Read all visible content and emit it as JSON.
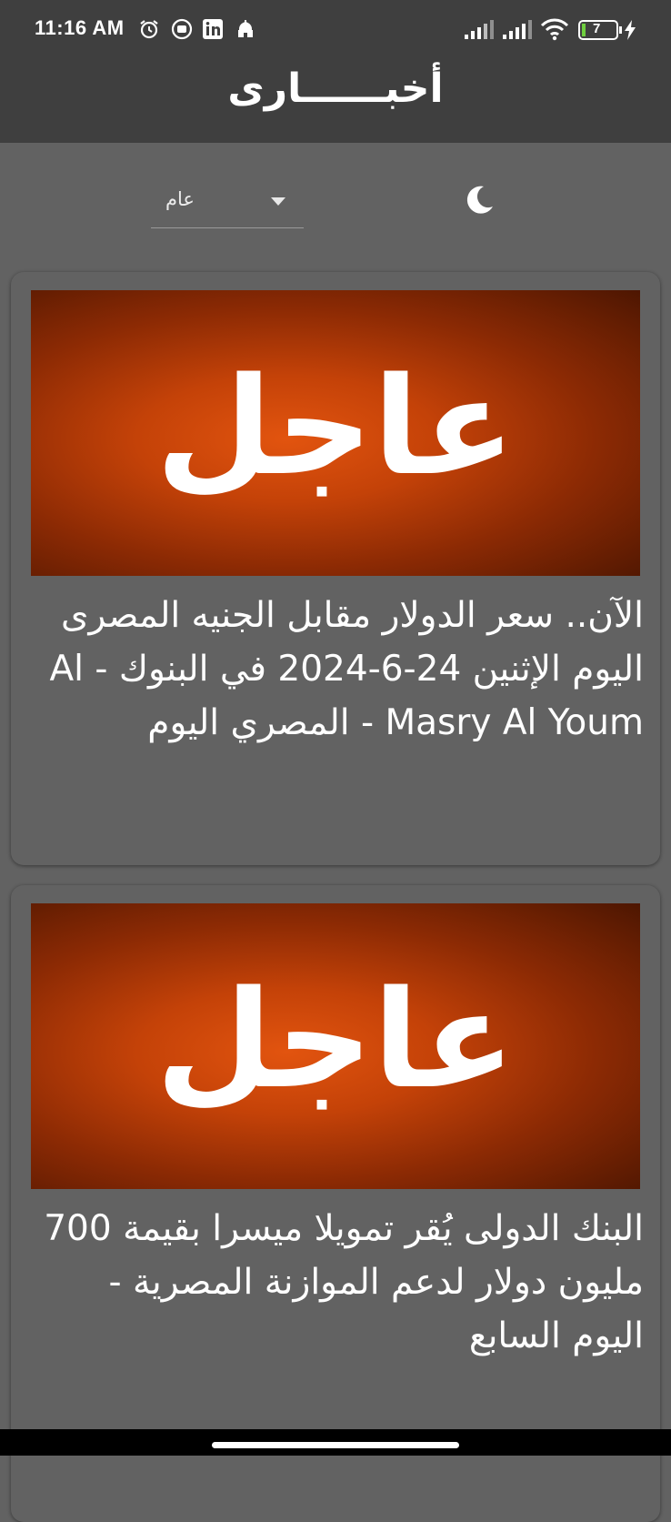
{
  "status_bar": {
    "time": "11:16 AM",
    "battery_level": "7",
    "icons": [
      "alarm-icon",
      "media-icon",
      "linkedin-icon",
      "mosque-icon",
      "signal-icon",
      "signal-icon",
      "wifi-icon",
      "battery-icon",
      "charging-icon"
    ]
  },
  "app_bar": {
    "title": "أخبــــــارى"
  },
  "filter": {
    "category": "عام",
    "theme_icon": "moon-icon"
  },
  "articles": [
    {
      "image_text": "عاجل",
      "title": "الآن.. سعر الدولار مقابل الجنيه المصرى اليوم الإثنين 24-6-2024 في البنوك - Al Masry Al Youm - المصري اليوم"
    },
    {
      "image_text": "عاجل",
      "title": "البنك الدولى يُقر تمويلا ميسرا بقيمة 700 مليون دولار لدعم الموازنة المصرية - اليوم السابع"
    }
  ],
  "colors": {
    "app_bar": "#3f3f3f",
    "background": "#626262",
    "image_accent": "#d0480a"
  }
}
